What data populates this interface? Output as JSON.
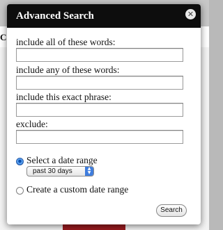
{
  "background": {
    "partial_text": "C"
  },
  "popup": {
    "title": "Advanced Search",
    "close_icon": "close-icon"
  },
  "fields": {
    "all_words_label": "include all of these words:",
    "all_words_value": "",
    "any_words_label": "include any of these words:",
    "any_words_value": "",
    "exact_phrase_label": "include this exact phrase:",
    "exact_phrase_value": "",
    "exclude_label": "exclude:",
    "exclude_value": ""
  },
  "date": {
    "option_range_label": "Select a date range",
    "option_range_selected": true,
    "range_select_value": "past 30 days",
    "option_custom_label": "Create a custom date range",
    "option_custom_selected": false
  },
  "actions": {
    "search_label": "Search"
  },
  "colors": {
    "titlebar": "#0d0d0d",
    "radio_selected": "#2a6fd1",
    "background_red": "#9a1b1f"
  }
}
